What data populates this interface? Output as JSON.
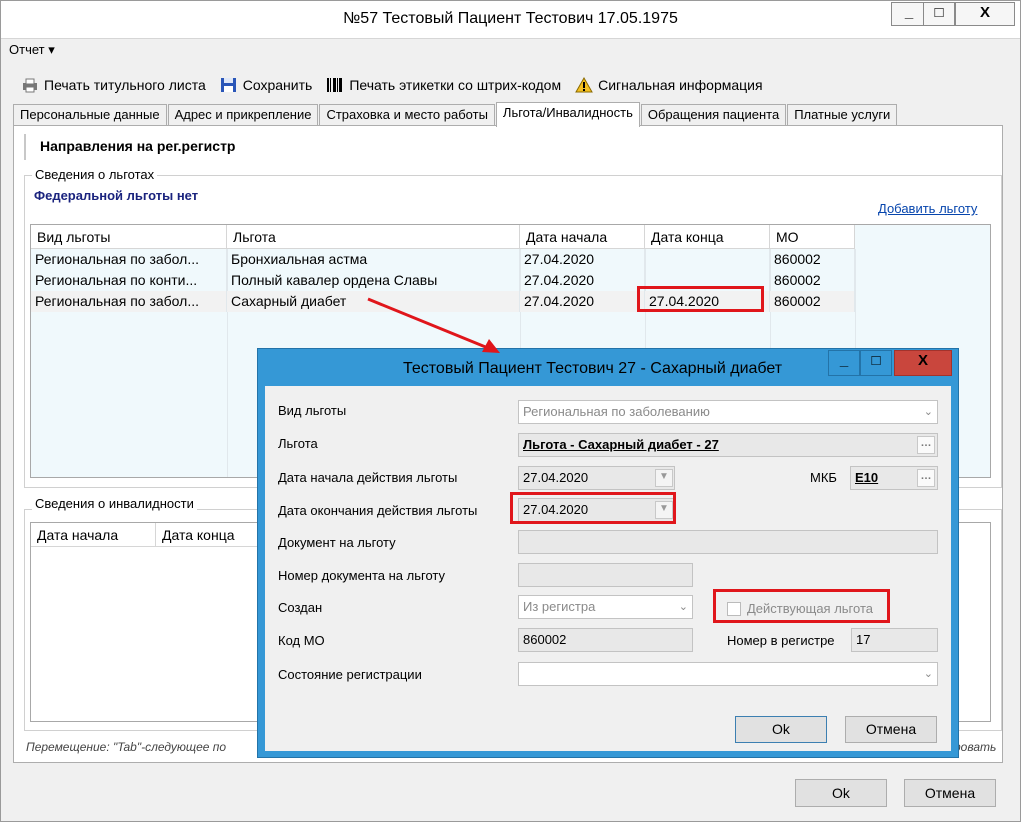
{
  "window": {
    "title": "№57 Тестовый Пациент Тестович 17.05.1975",
    "controls": {
      "minimize": "_",
      "maximize": "□",
      "close": "X"
    }
  },
  "menu": {
    "report": "Отчет ▾"
  },
  "toolbar": {
    "print_title": "Печать титульного листа",
    "save": "Сохранить",
    "print_labels": "Печать этикетки со штрих-кодом",
    "signal_info": "Сигнальная информация"
  },
  "tabs": [
    "Персональные данные",
    "Адрес и прикрепление",
    "Страховка и место работы",
    "Льгота/Инвалидность",
    "Обращения пациента",
    "Платные услуги"
  ],
  "panel": {
    "header": "Направления на рег.регистр",
    "benefits_group": "Сведения о льготах",
    "federal_note": "Федеральной льготы нет",
    "add_link": "Добавить льготу",
    "benefits_columns": [
      "Вид льготы",
      "Льгота",
      "Дата начала",
      "Дата конца",
      "МО"
    ],
    "benefits_rows": [
      [
        "Региональная по забол...",
        "Бронхиальная астма",
        "27.04.2020",
        "",
        "860002"
      ],
      [
        "Региональная по конти...",
        "Полный кавалер ордена Славы",
        "27.04.2020",
        "",
        "860002"
      ],
      [
        "Региональная по забол...",
        "Сахарный диабет",
        "27.04.2020",
        "27.04.2020",
        "860002"
      ]
    ],
    "disability_group": "Сведения о инвалидности",
    "disability_columns": [
      "Дата начала",
      "Дата конца"
    ],
    "hint": "Перемещение: \"Tab\"-следующее по",
    "hint_tail": "ровать"
  },
  "footer": {
    "ok": "Ok",
    "cancel": "Отмена"
  },
  "dialog": {
    "title": "Тестовый Пациент Тестович 27 - Сахарный диабет",
    "controls": {
      "minimize": "_",
      "maximize": "□",
      "close": "X"
    },
    "fields": {
      "kind_label": "Вид льготы",
      "kind_value": "Региональная по заболеванию",
      "benefit_label": "Льгота",
      "benefit_value": "Льгота - Сахарный диабет - 27",
      "start_label": "Дата начала действия льготы",
      "start_value": "27.04.2020",
      "mkb_label": "МКБ",
      "mkb_value": "E10",
      "end_label": "Дата окончания действия льготы",
      "end_value": "27.04.2020",
      "doc_label": "Документ на льготу",
      "doc_value": "",
      "docnum_label": "Номер документа на льготу",
      "docnum_value": "",
      "created_label": "Создан",
      "created_value": "Из регистра",
      "active_label": "Действующая льгота",
      "mo_label": "Код МО",
      "mo_value": "860002",
      "regnum_label": "Номер в регистре",
      "regnum_value": "17",
      "state_label": "Состояние регистрации",
      "state_value": ""
    },
    "ok": "Ok",
    "cancel": "Отмена"
  },
  "colors": {
    "accent": "#3598d6",
    "highlight": "#e0161b",
    "link": "#0645ad"
  }
}
